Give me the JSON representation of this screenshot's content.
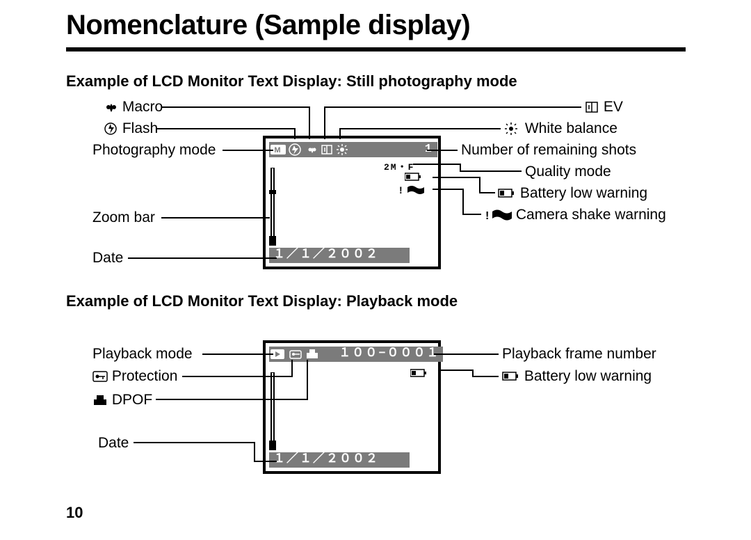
{
  "title": "Nomenclature (Sample display)",
  "page_number": "10",
  "section1": {
    "heading": "Example of LCD Monitor Text Display: Still photography mode",
    "frame": {
      "topbar_text": "        1",
      "quality_small": "2M・F",
      "date": "１／１／２００２"
    },
    "left_labels": {
      "macro": "Macro",
      "flash": "Flash",
      "photo_mode": "Photography mode",
      "zoom_bar": "Zoom bar",
      "date": "Date"
    },
    "right_labels": {
      "ev": "EV",
      "wb": "White balance",
      "remaining": "Number of remaining shots",
      "quality": "Quality mode",
      "battery": "Battery low warning",
      "shake": "Camera shake warning"
    }
  },
  "section2": {
    "heading": "Example of LCD Monitor Text Display: Playback mode",
    "frame": {
      "topbar_text": " １００−０００１",
      "date": "１／１／２００２"
    },
    "left_labels": {
      "playback_mode": "Playback mode",
      "protection": "Protection",
      "dpof": "DPOF",
      "date": "Date"
    },
    "right_labels": {
      "frame_no": "Playback frame number",
      "battery": "Battery low warning"
    }
  }
}
